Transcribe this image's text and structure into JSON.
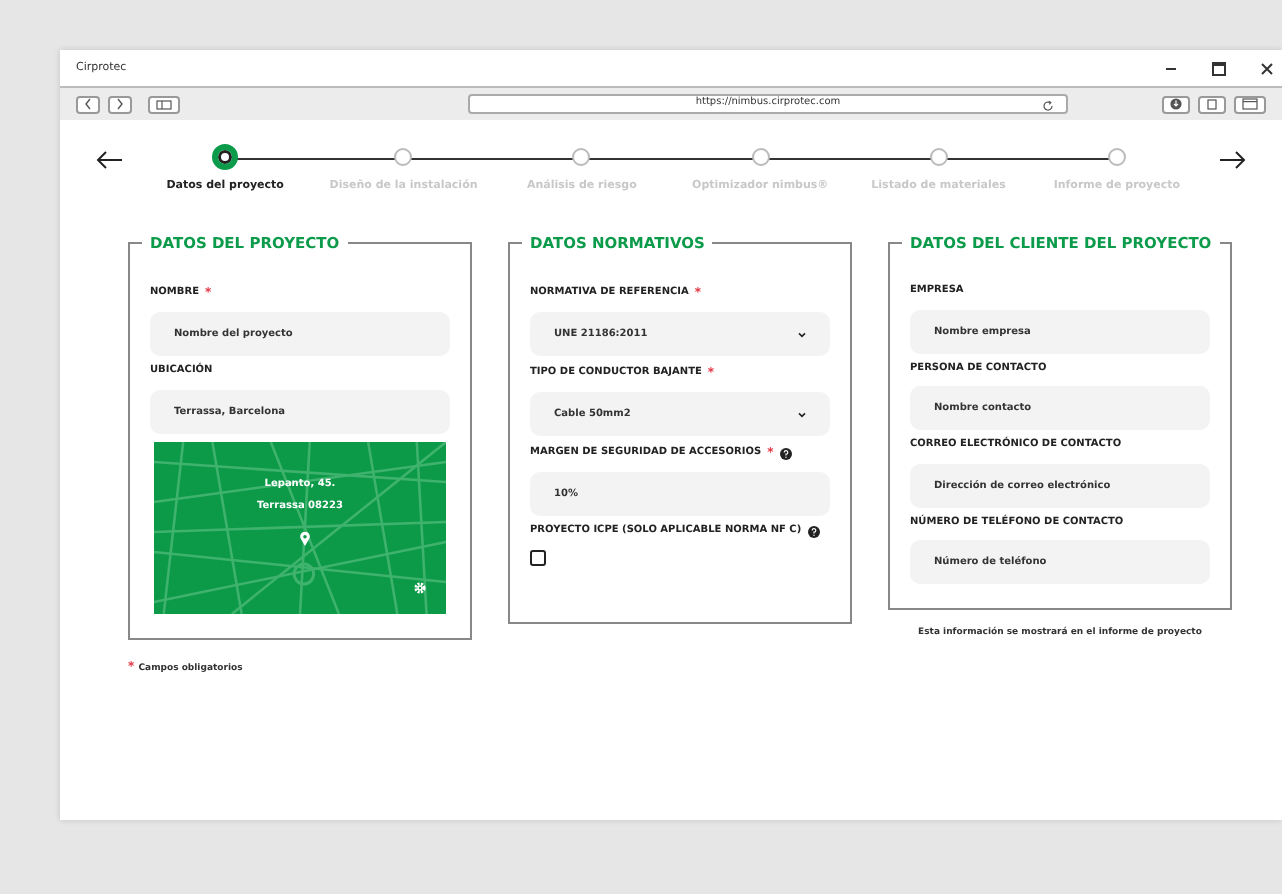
{
  "window": {
    "title": "Cirprotec",
    "url": "https://nimbus.cirprotec.com"
  },
  "steps": [
    {
      "label": "Datos del proyecto",
      "selected": true
    },
    {
      "label": "Diseño de la instalación",
      "selected": false
    },
    {
      "label": "Análisis de riesgo",
      "selected": false
    },
    {
      "label": "Optimizador nimbus®",
      "selected": false
    },
    {
      "label": "Listado de materiales",
      "selected": false
    },
    {
      "label": "Informe de proyecto",
      "selected": false
    }
  ],
  "panels": [
    {
      "title": "DATOS DEL PROYECTO",
      "fields": [
        {
          "kind": "text",
          "label": "NOMBRE",
          "required": true,
          "help": false,
          "placeholder": "Nombre del proyecto"
        },
        {
          "kind": "text",
          "label": "UBICACIÓN",
          "required": false,
          "help": false,
          "value": "Terrassa, Barcelona"
        },
        {
          "kind": "map",
          "lines": [
            "Lepanto, 45.",
            "Terrassa 08223"
          ]
        }
      ],
      "footnote": {
        "mark": "*",
        "text": "Campos obligatorios"
      }
    },
    {
      "title": "DATOS NORMATIVOS",
      "fields": [
        {
          "kind": "select",
          "label": "NORMATIVA DE REFERENCIA",
          "required": true,
          "help": false,
          "value": "UNE 21186:2011"
        },
        {
          "kind": "select",
          "label": "TIPO DE CONDUCTOR BAJANTE",
          "required": true,
          "help": false,
          "value": "Cable 50mm2"
        },
        {
          "kind": "text",
          "label": "MARGEN DE SEGURIDAD DE ACCESORIOS",
          "required": true,
          "help": true,
          "value": "10%"
        },
        {
          "kind": "checkbox",
          "label": "PROYECTO ICPE (SOLO APLICABLE NORMA NF C)",
          "required": false,
          "help": true,
          "checked": false
        }
      ]
    },
    {
      "title": "DATOS DEL CLIENTE DEL PROYECTO",
      "fields": [
        {
          "kind": "text",
          "label": "EMPRESA",
          "required": false,
          "help": false,
          "placeholder": "Nombre empresa"
        },
        {
          "kind": "text",
          "label": "PERSONA DE CONTACTO",
          "required": false,
          "help": false,
          "placeholder": "Nombre contacto"
        },
        {
          "kind": "text",
          "label": "CORREO ELECTRÓNICO DE CONTACTO",
          "required": false,
          "help": false,
          "placeholder": "Dirección de correo electrónico"
        },
        {
          "kind": "text",
          "label": "NÚMERO DE TELÉFONO DE CONTACTO",
          "required": false,
          "help": false,
          "placeholder": "Número de teléfono"
        }
      ],
      "footnote": {
        "text": "Esta información se mostrará en el informe de proyecto"
      }
    }
  ]
}
